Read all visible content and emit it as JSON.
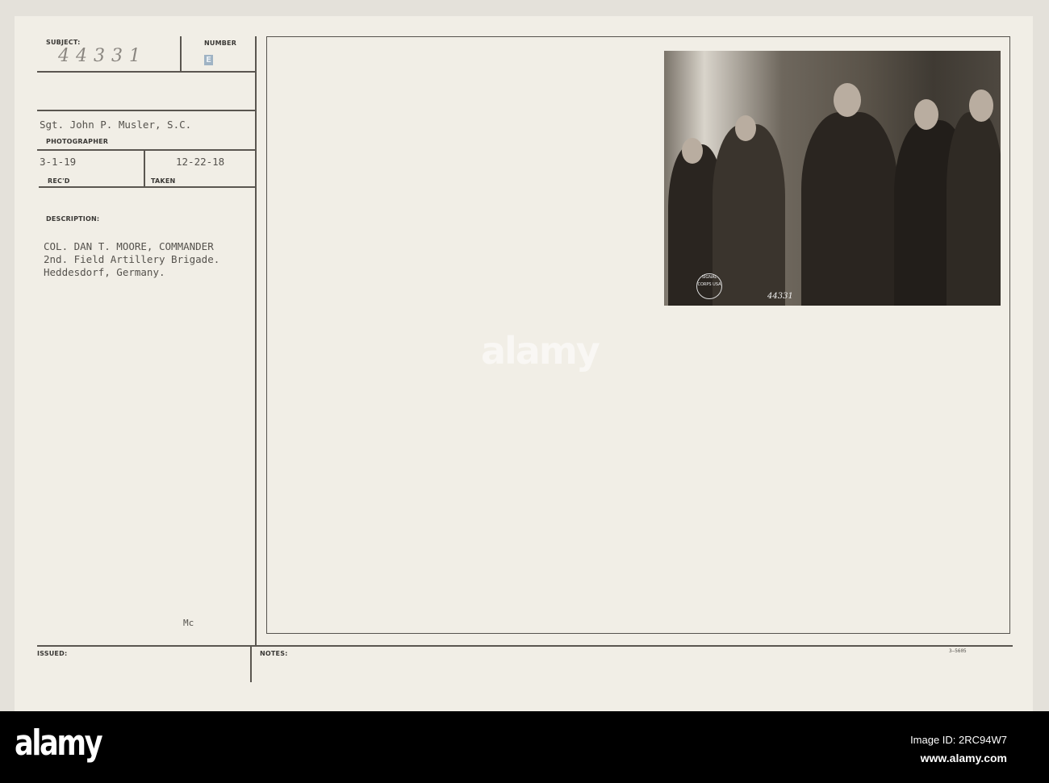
{
  "card": {
    "subject_label": "SUBJECT:",
    "subject_value": "44331",
    "number_label": "NUMBER",
    "number_value": "E",
    "photographer_value": "Sgt. John P. Musler, S.C.",
    "photographer_label": "PHOTOGRAPHER",
    "recd_value": "3-1-19",
    "recd_label": "REC'D",
    "taken_value": "12-22-18",
    "taken_label": "TAKEN",
    "description_label": "DESCRIPTION:",
    "description_lines": [
      "COL. DAN T. MOORE, COMMANDER",
      "2nd. Field Artillery Brigade.",
      "Heddesdorf, Germany."
    ],
    "initials": "Mc",
    "issued_label": "ISSUED:",
    "notes_label": "NOTES:",
    "form_number": "3—5605"
  },
  "photo": {
    "number": "44331",
    "seal_text": "SIGNAL CORPS USA"
  },
  "watermark": "alamy",
  "footer": {
    "logo": "alamy",
    "image_id": "Image ID: 2RC94W7",
    "url": "www.alamy.com"
  }
}
